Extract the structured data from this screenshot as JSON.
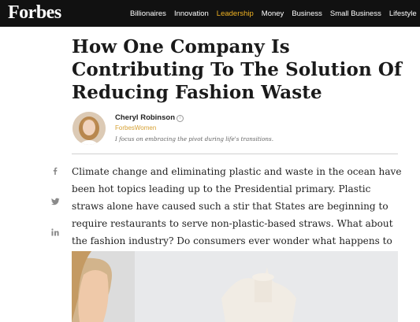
{
  "site": {
    "logo": "Forbes"
  },
  "nav": {
    "items": [
      {
        "label": "Billionaires"
      },
      {
        "label": "Innovation"
      },
      {
        "label": "Leadership"
      },
      {
        "label": "Money"
      },
      {
        "label": "Business"
      },
      {
        "label": "Small Business"
      },
      {
        "label": "Lifestyle"
      }
    ],
    "active": "Leadership",
    "active_color": "#f0b323"
  },
  "article": {
    "headline": "How One Company Is Contributing To The Solution Of Reducing Fashion Waste",
    "author": {
      "name": "Cheryl Robinson",
      "section": "ForbesWomen",
      "bio": "I focus on embracing the pivot during life's transitions."
    },
    "body": "Climate change and eliminating plastic and waste in the ocean have been hot topics leading up to the Presidential primary. Plastic straws alone have caused such a stir that States are beginning to require restaurants to serve non-plastic-based straws. What about the fashion industry? Do consumers ever wonder what happens to the seasonal styles that are never purchased?"
  },
  "share": {
    "icons": [
      "facebook-icon",
      "twitter-icon",
      "linkedin-icon"
    ]
  },
  "colors": {
    "topbar": "#111111",
    "accent": "#d6a133",
    "text": "#222222"
  }
}
